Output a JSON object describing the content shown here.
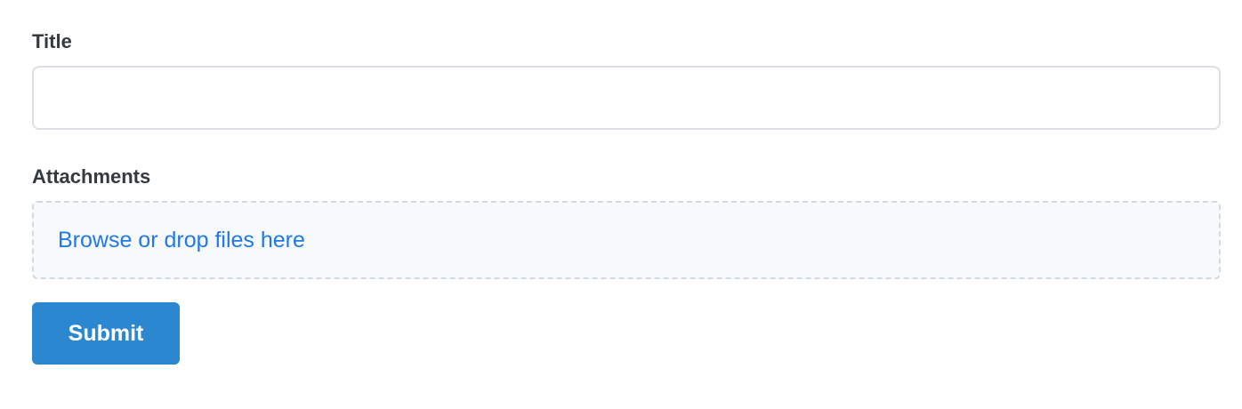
{
  "form": {
    "title_label": "Title",
    "title_value": "",
    "attachments_label": "Attachments",
    "dropzone_text": "Browse or drop files here",
    "submit_label": "Submit"
  },
  "colors": {
    "accent": "#2c87d1",
    "link": "#1f79e6",
    "label_text": "#343a40",
    "dropzone_background": "#f8f9fb",
    "border": "#dcdfe3"
  }
}
